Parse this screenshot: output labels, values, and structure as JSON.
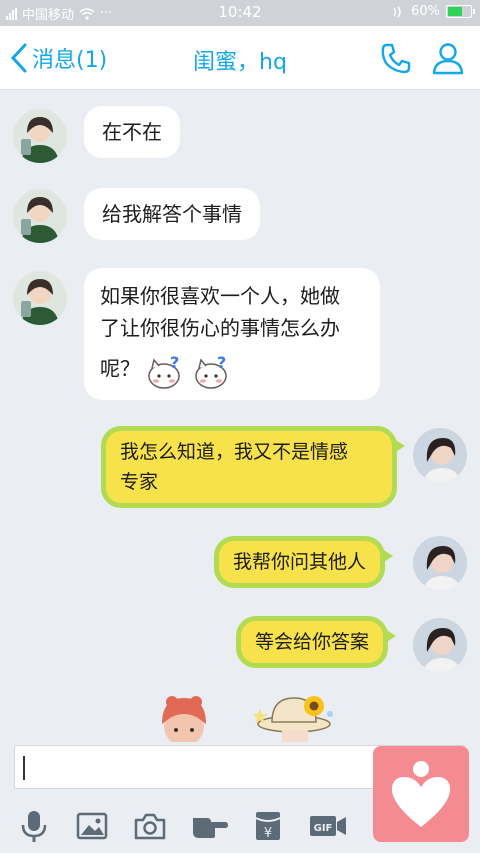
{
  "status": {
    "carrier": "中国移动",
    "time": "10:42",
    "battery": "60%",
    "battery_level": 0.6
  },
  "header": {
    "back_label": "消息(1)",
    "title": "闺蜜，hq"
  },
  "messages": [
    {
      "side": "in",
      "text": "在不在"
    },
    {
      "side": "in",
      "text": "给我解答个事情"
    },
    {
      "side": "in",
      "text_line1": "如果你很喜欢一个人，她做",
      "text_line2": "了让你很伤心的事情怎么办",
      "text_line3": "呢？"
    },
    {
      "side": "out",
      "text_line1": "我怎么知道，我又不是情感",
      "text_line2": "专家"
    },
    {
      "side": "out",
      "text": "我帮你问其他人"
    },
    {
      "side": "out",
      "text": "等会给你答案"
    }
  ],
  "input": {
    "value": ""
  },
  "toolbar": [
    "microphone-icon",
    "image-icon",
    "camera-icon",
    "poke-hand-icon",
    "red-packet-icon",
    "gif-icon",
    "heart-icon"
  ],
  "colors": {
    "accent": "#12a7e8",
    "bubble_out": "#f7e24c",
    "bubble_out_border": "#b2db53",
    "float_button": "#f48a92"
  }
}
